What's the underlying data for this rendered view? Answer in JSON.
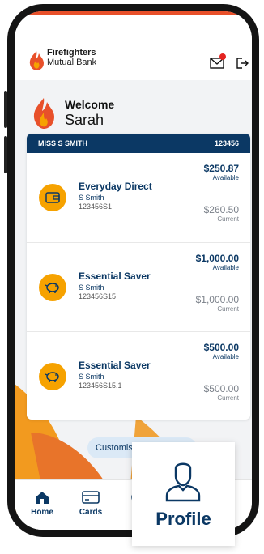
{
  "brand": {
    "line1": "Firefighters",
    "line2": "Mutual Bank"
  },
  "welcome": {
    "greeting": "Welcome",
    "name": "Sarah"
  },
  "card": {
    "holder_label": "MISS S SMITH",
    "customer_number": "123456",
    "accounts": [
      {
        "name": "Everyday Direct",
        "holder": "S Smith",
        "number": "123456S1",
        "available": "$250.87",
        "available_label": "Available",
        "current": "$260.50",
        "current_label": "Current",
        "icon": "wallet-icon"
      },
      {
        "name": "Essential Saver",
        "holder": "S Smith",
        "number": "123456S15",
        "available": "$1,000.00",
        "available_label": "Available",
        "current": "$1,000.00",
        "current_label": "Current",
        "icon": "piggy-bank-icon"
      },
      {
        "name": "Essential Saver",
        "holder": "S Smith",
        "number": "123456S15.1",
        "available": "$500.00",
        "available_label": "Available",
        "current": "$500.00",
        "current_label": "Current",
        "icon": "piggy-bank-icon"
      }
    ]
  },
  "customise_label": "Customise",
  "tabs": [
    {
      "label": "Home",
      "icon": "home-icon"
    },
    {
      "label": "Cards",
      "icon": "card-icon"
    },
    {
      "label": "P",
      "icon": "profile-icon"
    },
    {
      "label": "re",
      "icon": "more-icon"
    }
  ],
  "profile_popup": {
    "label": "Profile",
    "icon": "profile-icon"
  },
  "colors": {
    "navy": "#0b3864",
    "orange": "#f6a200",
    "accent_red": "#e8502a"
  }
}
